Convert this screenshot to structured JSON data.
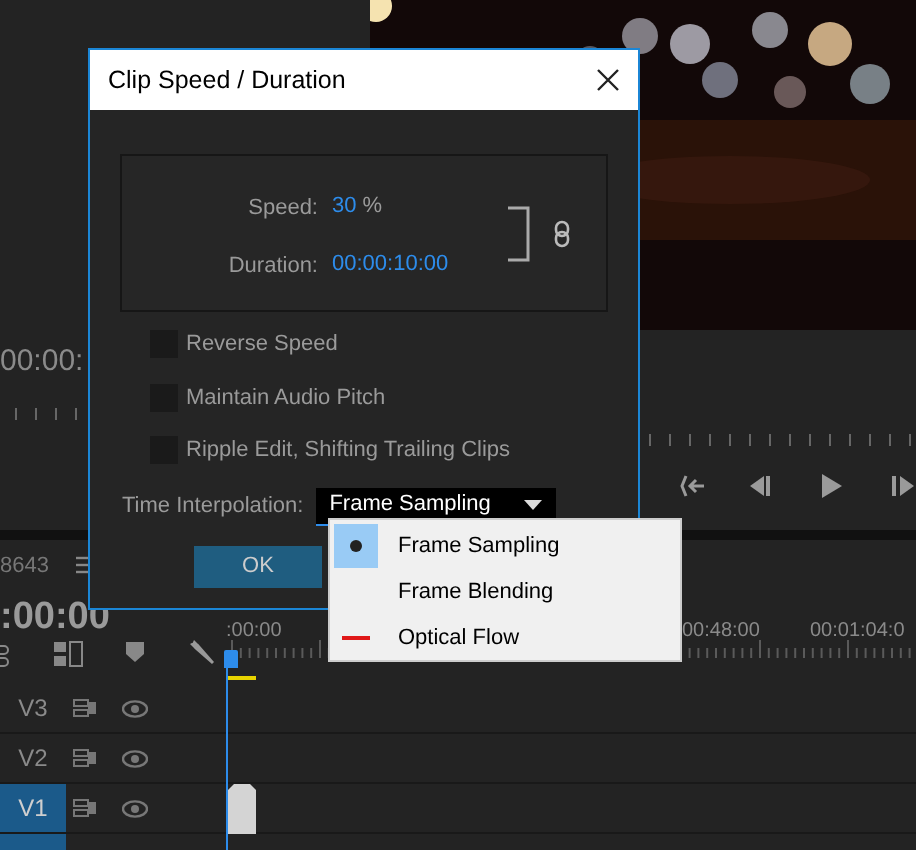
{
  "source_monitor": {
    "timecode": "00:00:"
  },
  "timeline": {
    "sequence_number": "8643",
    "timecode": ":00:00",
    "ruler_labels": [
      ":00:00",
      "00:48:00",
      "00:01:04:0"
    ],
    "tracks": [
      {
        "label": "V3",
        "selected": false,
        "clip": false
      },
      {
        "label": "V2",
        "selected": false,
        "clip": false
      },
      {
        "label": "V1",
        "selected": true,
        "clip": true
      }
    ]
  },
  "dialog": {
    "title": "Clip Speed / Duration",
    "speed": {
      "label": "Speed:",
      "value": "30",
      "unit": "%"
    },
    "duration": {
      "label": "Duration:",
      "value": "00:00:10:00"
    },
    "checkboxes": [
      {
        "label": "Reverse Speed",
        "checked": false
      },
      {
        "label": "Maintain Audio Pitch",
        "checked": false
      },
      {
        "label": "Ripple Edit, Shifting Trailing Clips",
        "checked": false
      }
    ],
    "interpolation": {
      "label": "Time Interpolation:",
      "value": "Frame Sampling"
    },
    "ok_button": "OK"
  },
  "dropdown_menu": [
    {
      "label": "Frame Sampling",
      "selected": true,
      "kind": "dot"
    },
    {
      "label": "Frame Blending",
      "selected": false,
      "kind": "plain"
    },
    {
      "label": "Optical Flow",
      "selected": false,
      "kind": "line"
    }
  ]
}
